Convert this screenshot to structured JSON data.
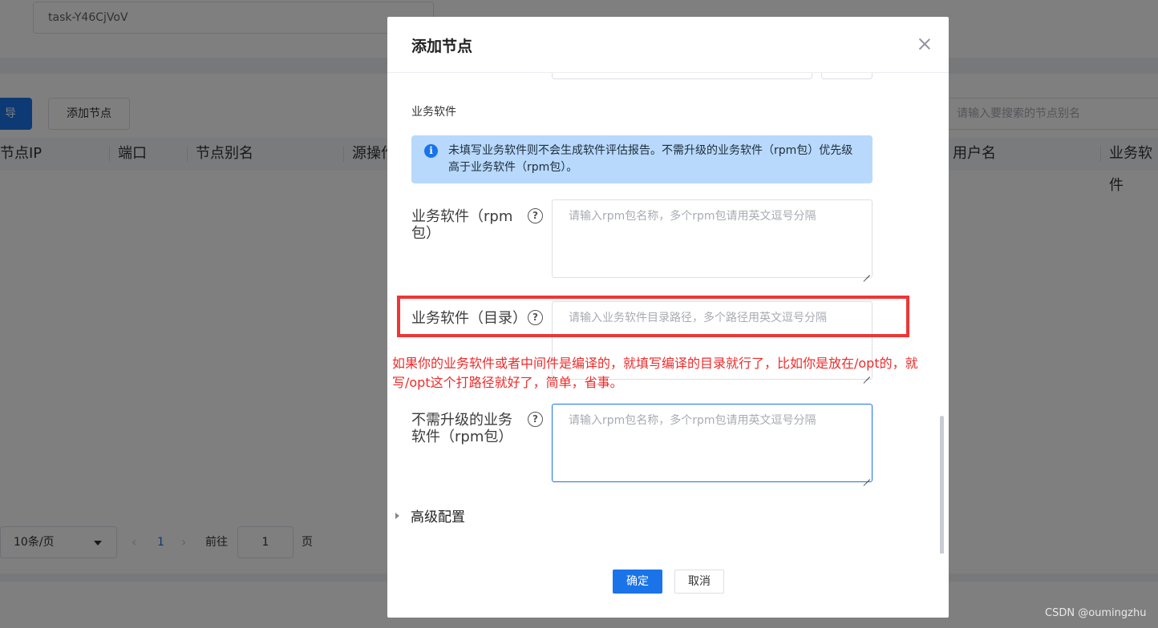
{
  "background": {
    "task_value": "task-Y46CjVoV",
    "import_button": "导入",
    "add_node_button": "添加节点",
    "search_placeholder": "请输入要搜索的节点别名",
    "columns": [
      "节点IP",
      "端口",
      "节点别名",
      "源操作",
      "用户名",
      "业务软件"
    ],
    "page_size": "10条/页",
    "current_page": "1",
    "goto_label": "前往",
    "goto_value": "1",
    "page_unit": "页"
  },
  "dialog": {
    "title": "添加节点",
    "section_title": "业务软件",
    "alert_text": "未填写业务软件则不会生成软件评估报告。不需升级的业务软件（rpm包）优先级高于业务软件（rpm包）。",
    "fields": [
      {
        "label": "业务软件（rpm包）",
        "placeholder": "请输入rpm包名称，多个rpm包请用英文逗号分隔"
      },
      {
        "label": "业务软件（目录）",
        "placeholder": "请输入业务软件目录路径，多个路径用英文逗号分隔"
      },
      {
        "label": "不需升级的业务软件（rpm包）",
        "placeholder": "请输入rpm包名称，多个rpm包请用英文逗号分隔"
      }
    ],
    "annotation": "如果你的业务软件或者中间件是编译的，就填写编译的目录就行了，比如你是放在/opt的，就写/opt这个打路径就好了，简单，省事。",
    "advanced": "高级配置",
    "confirm": "确定",
    "cancel": "取消"
  },
  "watermark": "CSDN @oumingzhu",
  "colors": {
    "primary": "#1a73e8",
    "alert_bg": "#b8d9fb",
    "annotation_red": "#ee2b2b"
  }
}
